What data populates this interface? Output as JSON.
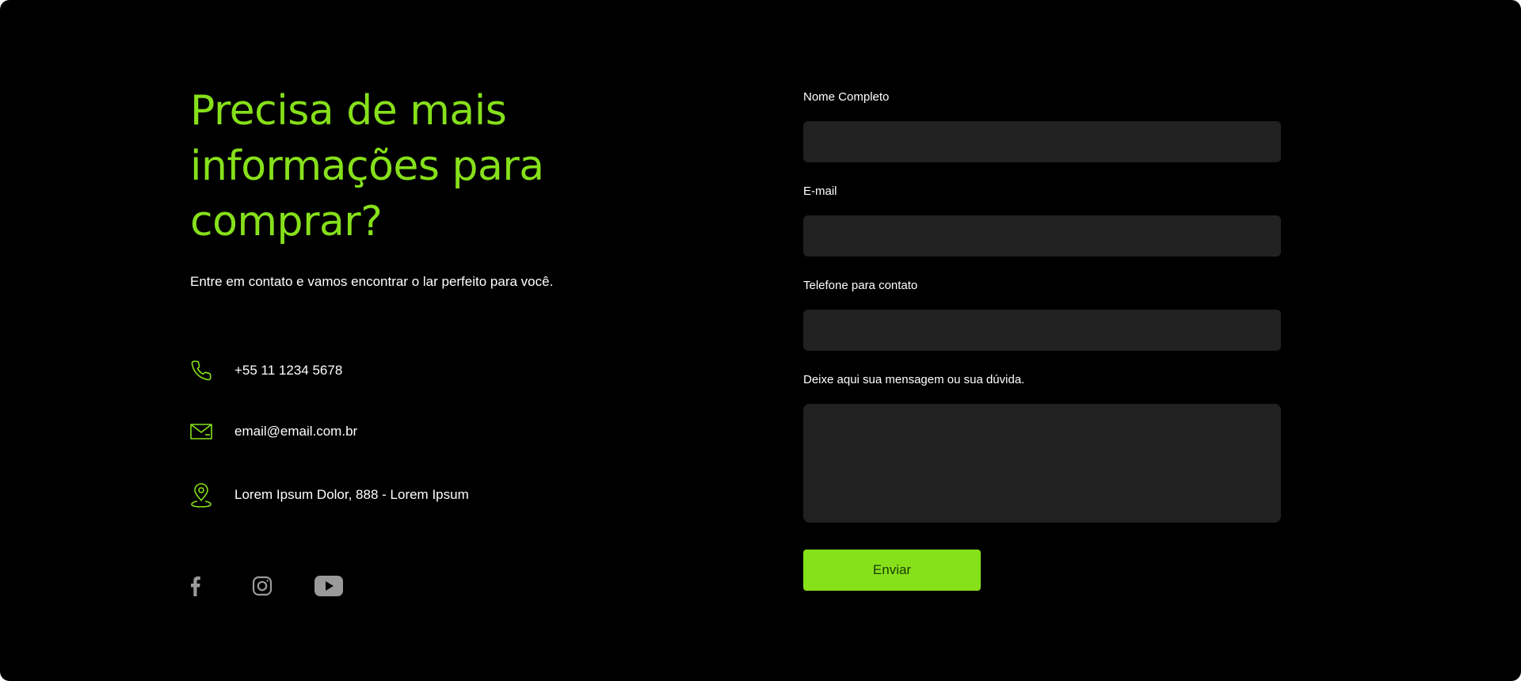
{
  "hero": {
    "headline": "Precisa de mais informações para comprar?",
    "subtitle": "Entre em contato e vamos encontrar o lar perfeito para você."
  },
  "contact": {
    "phone": {
      "icon": "phone-icon",
      "text": "+55 11 1234 5678"
    },
    "email": {
      "icon": "mail-icon",
      "text": "email@email.com.br"
    },
    "address": {
      "icon": "location-pin-icon",
      "text": "Lorem Ipsum Dolor, 888 - Lorem Ipsum"
    }
  },
  "socials": [
    {
      "icon": "facebook-icon"
    },
    {
      "icon": "instagram-icon"
    },
    {
      "icon": "youtube-icon"
    }
  ],
  "form": {
    "name_label": "Nome Completo",
    "name_value": "",
    "email_label": "E-mail",
    "email_value": "",
    "phone_label": "Telefone para contato",
    "phone_value": "",
    "message_label": "Deixe aqui sua mensagem ou sua dúvida.",
    "message_value": "",
    "submit_label": "Enviar"
  },
  "colors": {
    "background": "#000000",
    "accent": "#86e01a",
    "input_background": "#212121",
    "text": "#ffffff",
    "social_icon": "#9a9a9a"
  }
}
